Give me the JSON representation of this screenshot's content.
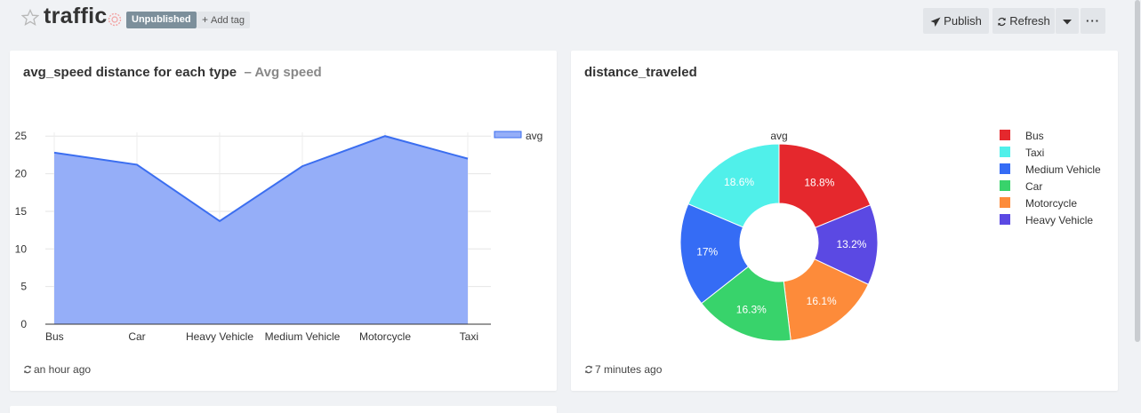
{
  "header": {
    "title": "traffic",
    "status_badge": "Unpublished",
    "add_tag": "Add tag",
    "publish_label": "Publish",
    "refresh_label": "Refresh",
    "more_label": "···"
  },
  "widgets": [
    {
      "title": "avg_speed distance for each type",
      "subtitle": "– Avg speed",
      "updated": "an hour ago"
    },
    {
      "title": "distance_traveled",
      "updated": "7 minutes ago"
    }
  ],
  "chart_data": [
    {
      "type": "area",
      "categories": [
        "Bus",
        "Car",
        "Heavy Vehicle",
        "Medium Vehicle",
        "Motorcycle",
        "Taxi"
      ],
      "series": [
        {
          "name": "avg",
          "values": [
            22.8,
            21.2,
            13.7,
            21.0,
            25.0,
            22.0
          ]
        }
      ],
      "yticks": [
        0,
        5,
        10,
        15,
        20,
        25
      ],
      "ylim": [
        0,
        25.5
      ],
      "grid": true,
      "legend": "top-right",
      "color": "#3b6ef0",
      "fill": "#95aef8"
    },
    {
      "type": "pie",
      "title": "avg",
      "labels": [
        "Bus",
        "Heavy Vehicle",
        "Motorcycle",
        "Car",
        "Medium Vehicle",
        "Taxi"
      ],
      "values": [
        18.8,
        13.2,
        16.1,
        16.3,
        17.0,
        18.6
      ],
      "value_labels": [
        "18.8%",
        "13.2%",
        "16.1%",
        "16.3%",
        "17%",
        "18.6%"
      ],
      "colors": [
        "#e5282d",
        "#5b49e3",
        "#fd8b3a",
        "#38d36b",
        "#356cf5",
        "#50f0ea"
      ],
      "legend": {
        "position": "right",
        "items": [
          "Bus",
          "Taxi",
          "Medium Vehicle",
          "Car",
          "Motorcycle",
          "Heavy Vehicle"
        ],
        "colors": [
          "#e5282d",
          "#50f0ea",
          "#356cf5",
          "#38d36b",
          "#fd8b3a",
          "#5b49e3"
        ]
      },
      "donut": true
    }
  ]
}
